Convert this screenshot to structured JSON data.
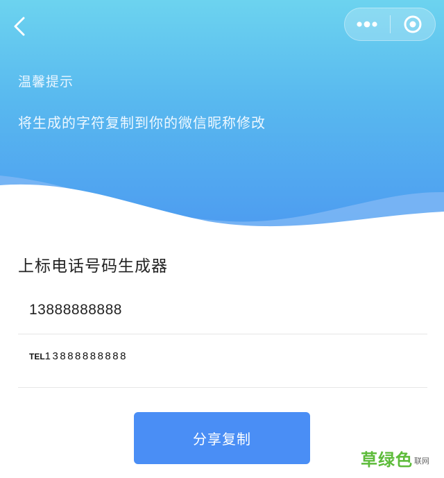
{
  "nav": {
    "back_icon": "chevron-left-icon",
    "more_icon": "more-dots-icon",
    "close_icon": "target-circle-icon"
  },
  "header": {
    "tip_title": "温馨提示",
    "tip_text": "将生成的字符复制到你的微信昵称修改",
    "gradient_top": "#6cd3ef",
    "gradient_bottom": "#4d9cf0"
  },
  "generator": {
    "title": "上标电话号码生成器",
    "phone_value": "13888888888",
    "output_prefix": "TEL",
    "output_number": "13888888888"
  },
  "actions": {
    "copy_label": "分享复制",
    "accent": "#4a8ef5"
  },
  "watermark": {
    "big": "草绿色",
    "small": "联网"
  }
}
